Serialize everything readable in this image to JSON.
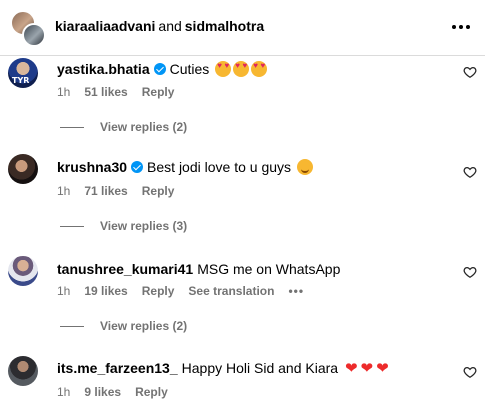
{
  "header": {
    "user1": "kiaraaliaadvani",
    "conjunction": "and",
    "user2": "sidmalhotra",
    "more_icon": "more-horizontal-icon"
  },
  "comments": [
    {
      "username": "yastika.bhatia",
      "verified": true,
      "text": "Cuties",
      "emojis": [
        "heart-eyes",
        "heart-eyes",
        "heart-eyes"
      ],
      "time": "1h",
      "likes": "51 likes",
      "reply": "Reply",
      "view_replies": "View replies (2)"
    },
    {
      "username": "krushna30",
      "verified": true,
      "text": "Best jodi love to u guys",
      "emojis": [
        "hugging-face"
      ],
      "time": "1h",
      "likes": "71 likes",
      "reply": "Reply",
      "view_replies": "View replies (3)"
    },
    {
      "username": "tanushree_kumari41",
      "verified": false,
      "text": "MSG me on WhatsApp",
      "emojis": [],
      "time": "1h",
      "likes": "19 likes",
      "reply": "Reply",
      "see_translation": "See translation",
      "more": "•••",
      "view_replies": "View replies (2)"
    },
    {
      "username": "its.me_farzeen13_",
      "verified": false,
      "text": "Happy Holi Sid and Kiara",
      "emojis": [
        "red-heart",
        "red-heart",
        "red-heart"
      ],
      "time": "1h",
      "likes": "9 likes",
      "reply": "Reply"
    }
  ],
  "colors": {
    "verified": "#0095f6",
    "meta_text": "#737373",
    "divider": "#dbdbdb",
    "red_heart": "#ed2b2b"
  }
}
